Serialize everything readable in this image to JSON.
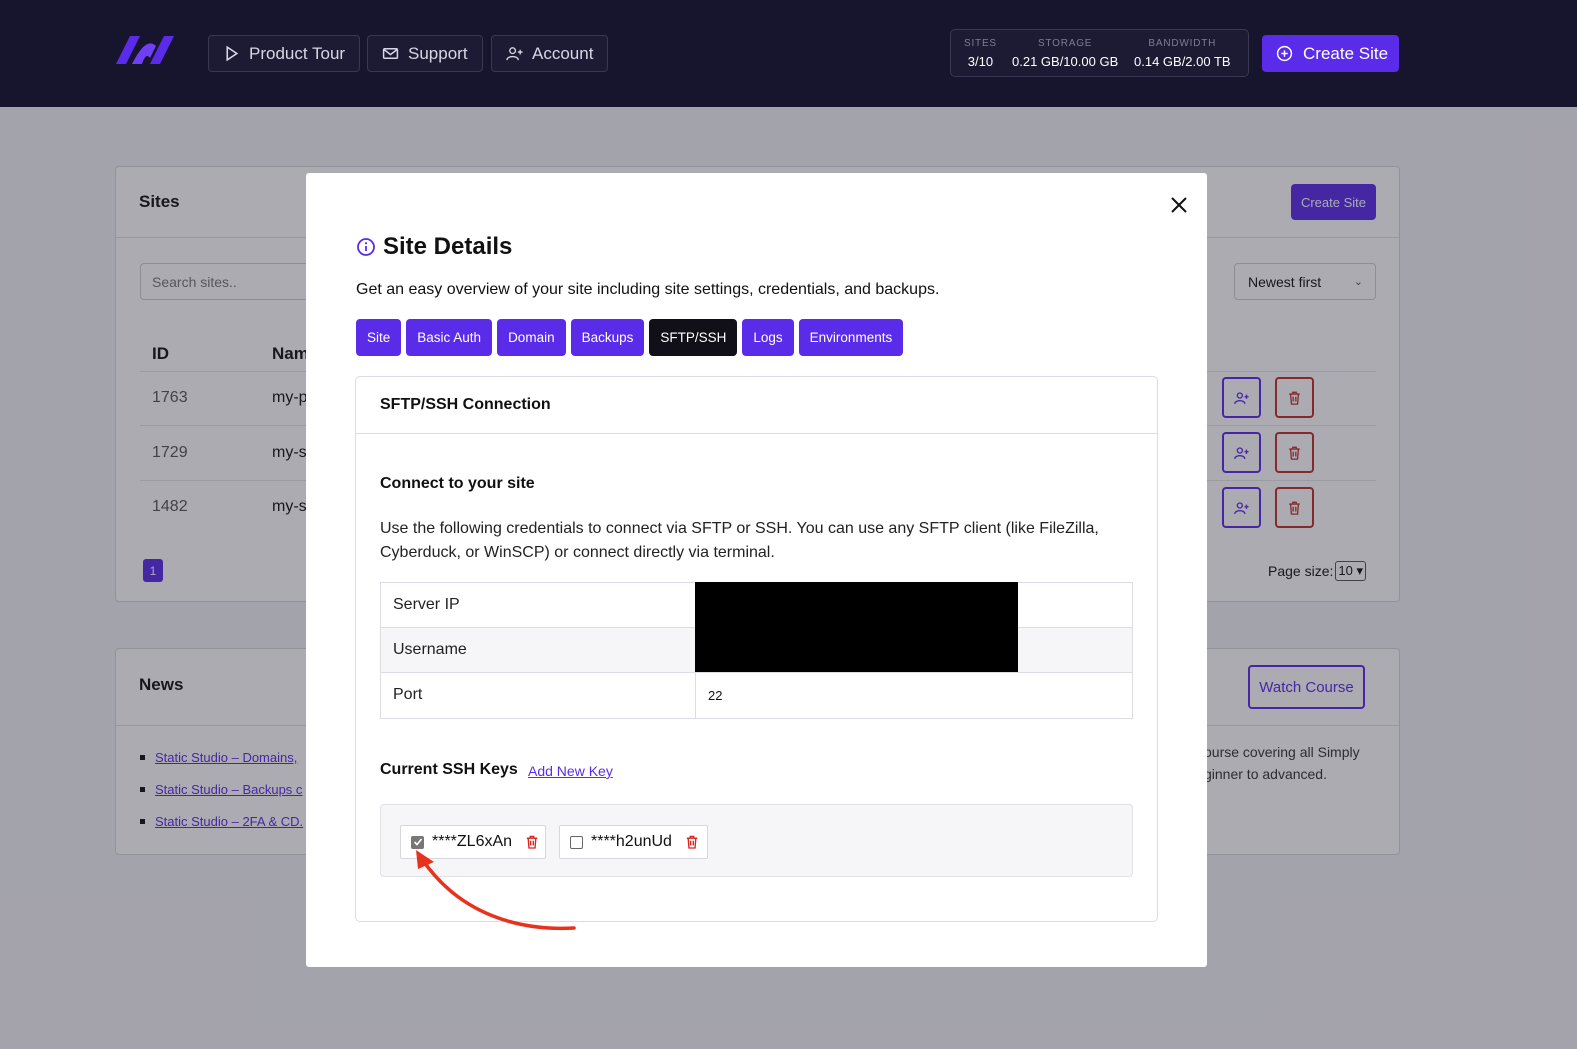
{
  "topbar": {
    "nav": [
      "Product Tour",
      "Support",
      "Account"
    ],
    "stats": [
      {
        "label": "SITES",
        "value": "3/10"
      },
      {
        "label": "STORAGE",
        "value": "0.21 GB/10.00 GB"
      },
      {
        "label": "BANDWIDTH",
        "value": "0.14 GB/2.00 TB"
      }
    ],
    "create_label": "Create Site"
  },
  "sites": {
    "title": "Sites",
    "create_label": "Create Site",
    "search_placeholder": "Search sites..",
    "sort": "Newest first",
    "columns": [
      "ID",
      "Nam"
    ],
    "rows": [
      {
        "id": "1763",
        "name": "my-p"
      },
      {
        "id": "1729",
        "name": "my-s"
      },
      {
        "id": "1482",
        "name": "my-s"
      }
    ],
    "page": "1",
    "page_size_label": "Page size:",
    "page_size": "10"
  },
  "news": {
    "title": "News",
    "watch_label": "Watch Course",
    "links": [
      "Static Studio – Domains,",
      "Static Studio – Backups c",
      "Static Studio – 2FA & CD."
    ],
    "text_1": "ourse covering all Simply",
    "text_2": "ginner to advanced."
  },
  "modal": {
    "title": "Site Details",
    "description": "Get an easy overview of your site including site settings, credentials, and backups.",
    "tabs": [
      "Site",
      "Basic Auth",
      "Domain",
      "Backups",
      "SFTP/SSH",
      "Logs",
      "Environments"
    ],
    "active_tab": "SFTP/SSH",
    "card_title": "SFTP/SSH Connection",
    "connect_title": "Connect to your site",
    "connect_text": "Use the following credentials to connect via SFTP or SSH. You can use any SFTP client (like FileZilla, Cyberduck, or WinSCP) or connect directly via terminal.",
    "credentials": [
      {
        "label": "Server IP",
        "value": ""
      },
      {
        "label": "Username",
        "value": ""
      },
      {
        "label": "Port",
        "value": "22"
      }
    ],
    "keys_title": "Current SSH Keys",
    "add_key_label": "Add New Key",
    "keys": [
      {
        "name": "****ZL6xAn",
        "checked": true
      },
      {
        "name": "****h2unUd",
        "checked": false
      }
    ]
  },
  "colors": {
    "accent": "#5b2bea",
    "topbar": "#17142d",
    "danger": "#c0302a",
    "arrow": "#e8321e"
  }
}
